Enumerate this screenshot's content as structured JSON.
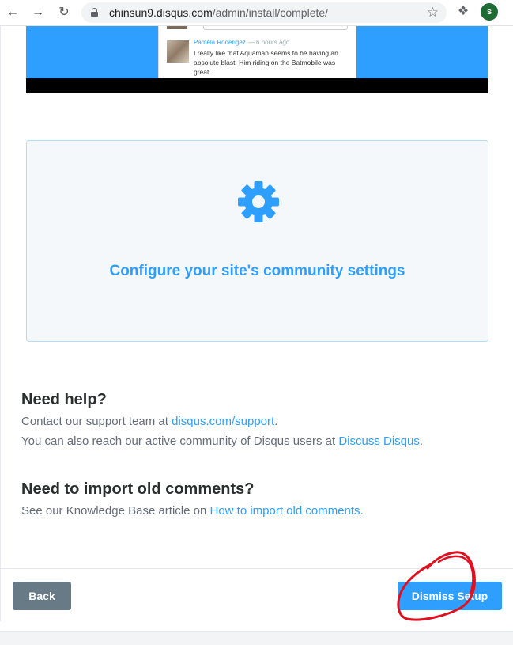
{
  "browser": {
    "url_domain": "chinsun9.disqus.com",
    "url_path": "/admin/install/complete/",
    "profile_initial": "s"
  },
  "preview": {
    "commenter_name": "Pamela Roderigez",
    "comment_time": "6 hours ago",
    "comment_text": "I really like that Aquaman seems to be having an absolute blast. Him riding on the Batmobile was great."
  },
  "config_card": {
    "icon": "gear-icon",
    "title": "Configure your site's community settings"
  },
  "help": {
    "title": "Need help?",
    "line1_prefix": "Contact our support team at ",
    "line1_link": "disqus.com/support",
    "line1_suffix": ".",
    "line2_prefix": "You can also reach our active community of Disqus users at ",
    "line2_link": "Discuss Disqus",
    "line2_suffix": "."
  },
  "import": {
    "title": "Need to import old comments?",
    "line_prefix": "See our Knowledge Base article on ",
    "line_link": "How to import old comments",
    "line_suffix": "."
  },
  "footer": {
    "back_label": "Back",
    "dismiss_label": "Dismiss Setup"
  },
  "colors": {
    "accent": "#2e9fff",
    "muted_text": "#656c7a",
    "back_button": "#687a86",
    "annotation": "#e0101e"
  }
}
